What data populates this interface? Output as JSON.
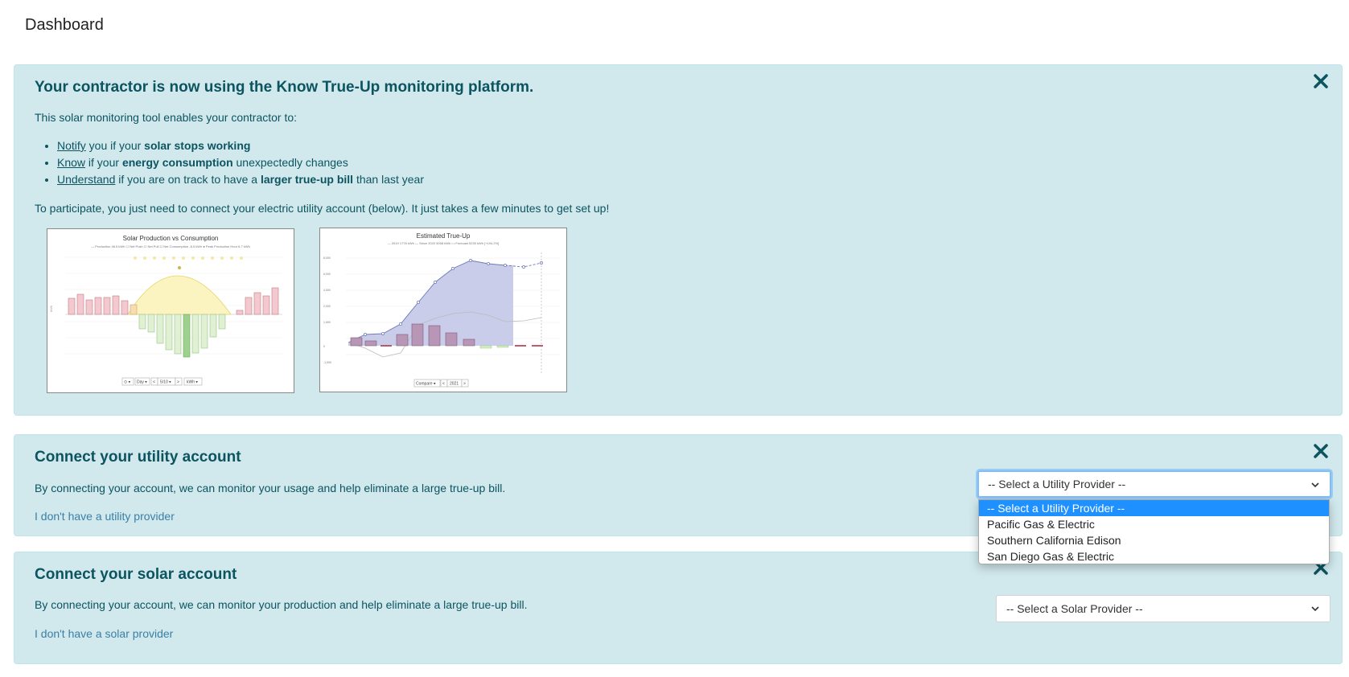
{
  "page": {
    "title": "Dashboard"
  },
  "intro": {
    "heading": "Your contractor is now using the Know True-Up monitoring platform.",
    "lead": "This solar monitoring tool enables your contractor to:",
    "features": [
      {
        "link": "Notify",
        "pre": " you if your ",
        "bold": "solar stops working",
        "post": ""
      },
      {
        "link": "Know",
        "pre": " if your ",
        "bold": "energy consumption",
        "post": " unexpectedly changes"
      },
      {
        "link": "Understand",
        "pre": " if you are on track to have a ",
        "bold": "larger true-up bill",
        "post": " than last year"
      }
    ],
    "participate": "To participate, you just need to connect your electric utility account (below). It just takes a few minutes to get set up!",
    "chart1": {
      "title": "Solar Production vs Consumption",
      "legend": "— Production 46.5 kWh   ☐ Net Push   ☐ Net Pull   ☐ Net Consumption -8.5 kWh   ● Peak Production Hour 6.7 kWh",
      "controls": [
        "⊙ ▾",
        "Day ▾",
        "<",
        "5/10 ▾",
        ">",
        "kWh ▾"
      ]
    },
    "chart2": {
      "title": "Estimated True-Up",
      "legend": "— 2019 1778 kWh   — Since 2020 5058 kWh   • • Forecast 5230 kWh [+194.2%]",
      "controls": [
        "Compare ▾",
        "<",
        "2021",
        ">"
      ]
    }
  },
  "utility": {
    "heading": "Connect your utility account",
    "description": "By connecting your account, we can monitor your usage and help eliminate a large true-up bill.",
    "no_provider_link": "I don't have a utility provider",
    "select_value": "-- Select a Utility Provider --",
    "options": [
      "-- Select a Utility Provider --",
      "Pacific Gas & Electric",
      "Southern California Edison",
      "San Diego Gas & Electric"
    ]
  },
  "solar": {
    "heading": "Connect your solar account",
    "description": "By connecting your account, we can monitor your production and help eliminate a large true-up bill.",
    "no_provider_link": "I don't have a solar provider",
    "select_value": "-- Select a Solar Provider --"
  },
  "colors": {
    "card_bg": "#d1e9ed",
    "text": "#0c5460",
    "link": "#3a7fa6",
    "dropdown_selected": "#1e90ff"
  },
  "icons": {
    "close": "close-icon",
    "chevron": "chevron-down-icon"
  }
}
